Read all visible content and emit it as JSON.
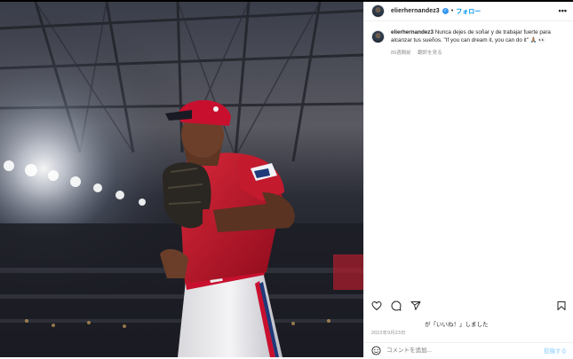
{
  "header": {
    "username": "elierhernandez3",
    "separator": "•",
    "follow_label": "フォロー",
    "more_label": "•••"
  },
  "caption": {
    "username": "elierhernandez3",
    "text": "Nunca dejes de soñar y de trabajar fuerte para alcanzar tus sueños. \"If you can dream it, you can do it\" 🙏🏽 👀",
    "time_ago": "89週間前",
    "translate_label": "翻訳を見る"
  },
  "actions": {
    "like_icon": "heart-icon",
    "comment_icon": "comment-icon",
    "share_icon": "paper-plane-icon",
    "save_icon": "bookmark-icon"
  },
  "likes": {
    "text": "が「いいね！」しました"
  },
  "post_date": "2022年9月23日",
  "comment": {
    "placeholder": "コメントを追加...",
    "post_label": "投稿する",
    "emoji_icon": "smiley-icon"
  },
  "colors": {
    "link_blue": "#0095f6",
    "verified_blue": "#3897f0",
    "muted_gray": "#8e8e8e",
    "jersey_red": "#c8102e"
  }
}
